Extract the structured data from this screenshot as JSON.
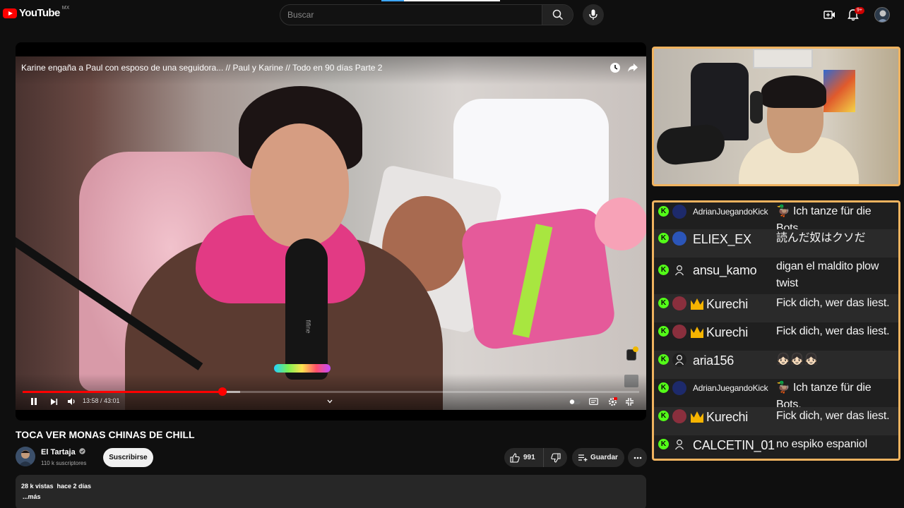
{
  "header": {
    "logo_text": "YouTube",
    "country_code": "MX",
    "search_placeholder": "Buscar",
    "notification_count": "9+"
  },
  "player": {
    "overlay_title": "Karine engaña a Paul con esposo de una seguidora... // Paul y Karine // Todo en 90 días Parte 2",
    "current_time": "13:58",
    "duration": "43:01",
    "time_display": "13:58 / 43:01",
    "progress": 0.3246,
    "mic_brand_text": "fifine"
  },
  "video": {
    "heading": "TOCA VER MONAS CHINAS DE CHILL",
    "channel_name": "El Tartaja",
    "channel_subs": "110 k suscriptores",
    "subscribe_label": "Suscribirse",
    "like_count": "991",
    "save_label": "Guardar",
    "views_date": "28 k vistas  hace 2 días",
    "more_label": "...más"
  },
  "chat": {
    "badge_letter": "K",
    "messages": [
      {
        "user": "AdrianJuegandoKick",
        "text": "🦆 Ich tanze für die Bots.",
        "avatar": "blue-helmet",
        "crown": false
      },
      {
        "user": "ELIEX_EX",
        "text": "読んだ奴はクソだ",
        "avatar": "blue-character",
        "crown": false
      },
      {
        "user": "ansu_kamo",
        "text": "digan el maldito plow twist",
        "avatar": "default-user",
        "crown": false
      },
      {
        "user": "Kurechi",
        "text": "Fick dich, wer das liest.",
        "avatar": "red-character",
        "crown": true
      },
      {
        "user": "Kurechi",
        "text": "Fick dich, wer das liest.",
        "avatar": "red-character",
        "crown": true
      },
      {
        "user": "aria156",
        "text": "👧🏻👧🏻👧🏻",
        "avatar": "default-user",
        "crown": false
      },
      {
        "user": "AdrianJuegandoKick",
        "text": "🦆 Ich tanze für die Bots.",
        "avatar": "blue-helmet",
        "crown": false
      },
      {
        "user": "Kurechi",
        "text": "Fick dich, wer das liest.",
        "avatar": "red-character",
        "crown": true
      },
      {
        "user": "CALCETIN_01",
        "text": "no espiko espaniol",
        "avatar": "default-user",
        "crown": false
      }
    ]
  },
  "colors": {
    "brand_red": "#ff0000",
    "overlay_border": "#f0b35f",
    "kick_green": "#53fc18",
    "crown_gold": "#f6b400"
  }
}
